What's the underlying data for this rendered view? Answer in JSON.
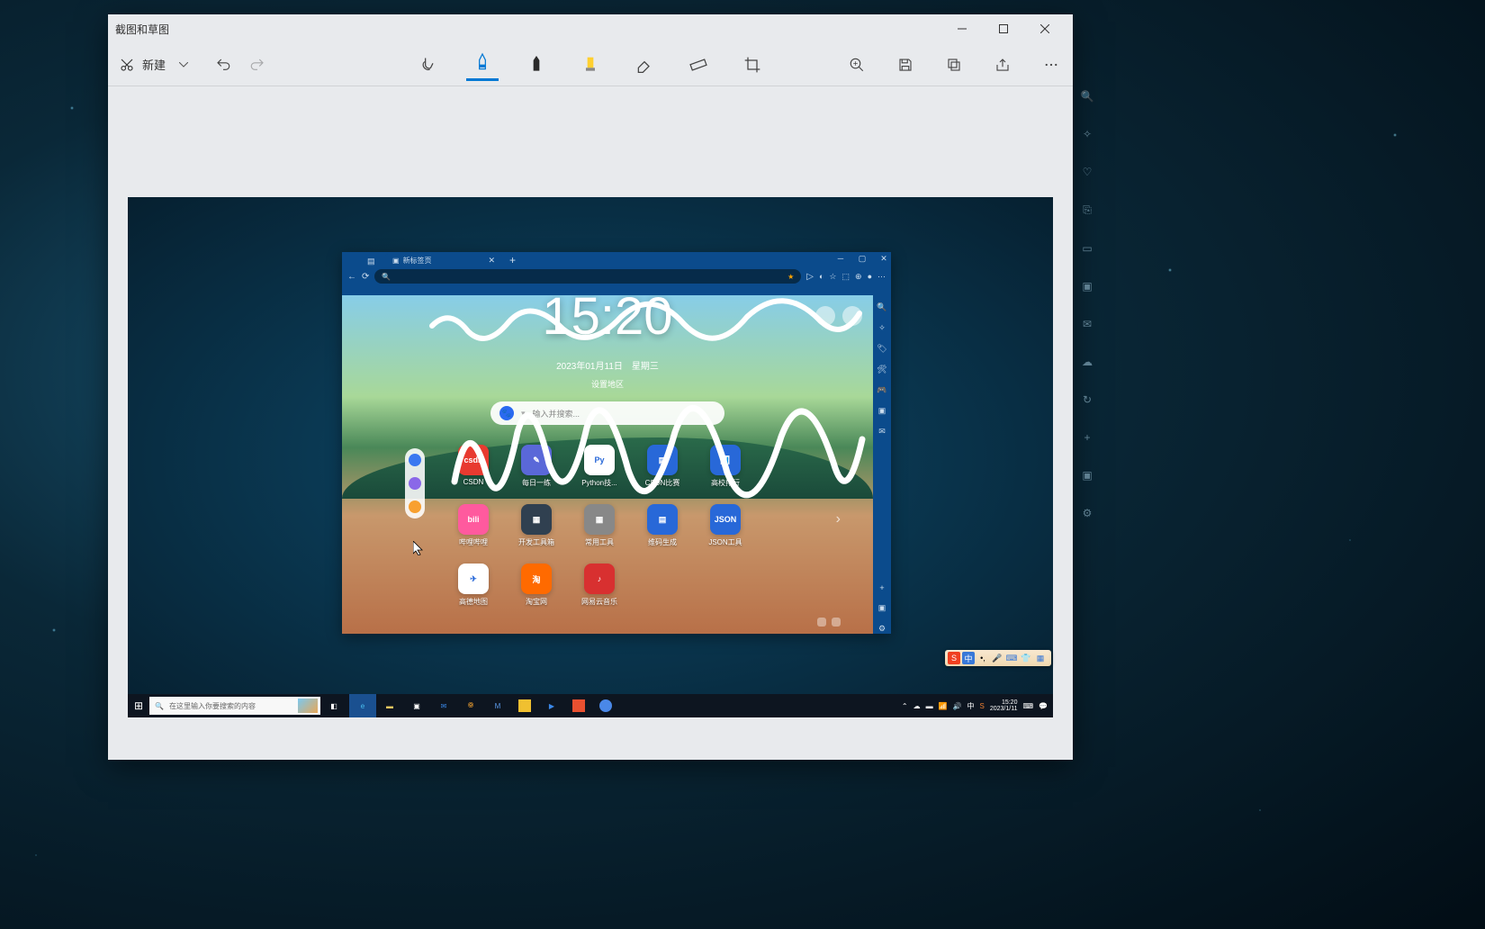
{
  "window": {
    "title": "截图和草图",
    "new_label": "新建"
  },
  "browser": {
    "tab_title": "新标签页",
    "clock": "15:20",
    "date": "2023年01月11日",
    "weekday": "星期三",
    "region": "设置地区",
    "search_placeholder": "输入并搜索...",
    "tiles": [
      {
        "label": "CSDN",
        "color": "#e83a30",
        "text": "csdn"
      },
      {
        "label": "每日一练",
        "color": "#5a68d8",
        "text": "✎"
      },
      {
        "label": "Python技...",
        "color": "#ffffff",
        "text": "Py"
      },
      {
        "label": "CSDN比赛",
        "color": "#2868d8",
        "text": "▤"
      },
      {
        "label": "高校排行",
        "color": "#2868d8",
        "text": "📊"
      },
      {
        "label": "哔哩哔哩",
        "color": "#ff5a9e",
        "text": "bili"
      },
      {
        "label": "开发工具箱",
        "color": "#304050",
        "text": "▦"
      },
      {
        "label": "常用工具",
        "color": "#888888",
        "text": "▦"
      },
      {
        "label": "维码生成",
        "color": "#2868d8",
        "text": "▤"
      },
      {
        "label": "JSON工具",
        "color": "#2868d8",
        "text": "JSON"
      },
      {
        "label": "高德地图",
        "color": "#ffffff",
        "text": "✈"
      },
      {
        "label": "淘宝网",
        "color": "#ff6a00",
        "text": "淘"
      },
      {
        "label": "网易云音乐",
        "color": "#d83030",
        "text": "♪"
      }
    ]
  },
  "taskbar": {
    "search_placeholder": "在这里输入你要搜索的内容",
    "time": "15:20",
    "date": "2023/1/11",
    "ime": "中"
  },
  "ime": {
    "main": "中"
  }
}
